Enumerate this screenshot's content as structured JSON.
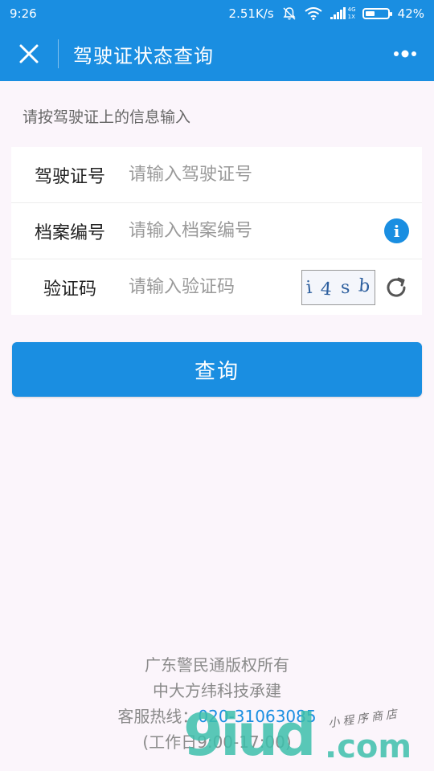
{
  "status_bar": {
    "time": "9:26",
    "net_speed": "2.51K/s",
    "network_type_top": "4G",
    "network_type_bottom": "1X",
    "battery_percent_text": "42%",
    "battery_level": 0.42
  },
  "navbar": {
    "title": "驾驶证状态查询"
  },
  "hint": "请按驾驶证上的信息输入",
  "form": {
    "license": {
      "label": "驾驶证号",
      "placeholder": "请输入驾驶证号"
    },
    "archive": {
      "label": "档案编号",
      "placeholder": "请输入档案编号"
    },
    "captcha": {
      "label": "验证码",
      "placeholder": "请输入验证码",
      "code": [
        "i",
        "4",
        "s",
        "b"
      ]
    }
  },
  "query_button": "查询",
  "footer": {
    "line1": "广东警民通版权所有",
    "line2": "中大方纬科技承建",
    "hotline_label": "客服热线：",
    "hotline_number": "020-31063085",
    "hours": "(工作日9:00-17:00)"
  },
  "watermark": {
    "brand": "9iud",
    "domain": ".com",
    "subtitle": "小程序商店"
  },
  "colors": {
    "primary": "#1a8ee1",
    "background": "#fbf5fb"
  }
}
